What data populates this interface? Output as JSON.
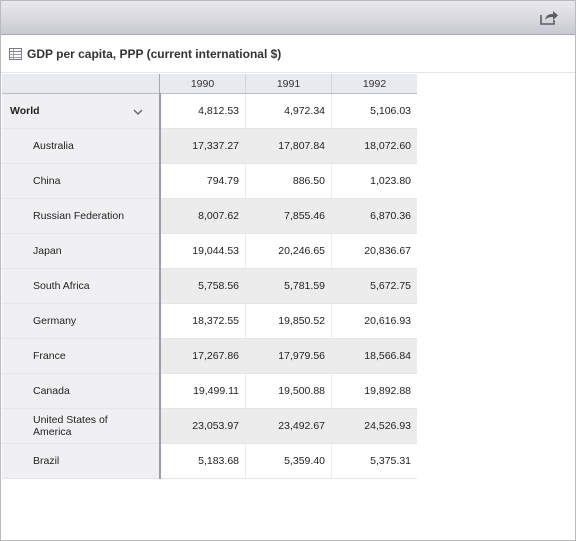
{
  "header": {
    "title": "GDP per capita, PPP (current international $)",
    "share_icon": "share-icon",
    "table_icon": "table-icon"
  },
  "table": {
    "columns": [
      "1990",
      "1991",
      "1992"
    ],
    "rows": [
      {
        "label": "World",
        "values": [
          "4,812.53",
          "4,972.34",
          "5,106.03"
        ]
      },
      {
        "label": "Australia",
        "values": [
          "17,337.27",
          "17,807.84",
          "18,072.60"
        ]
      },
      {
        "label": "China",
        "values": [
          "794.79",
          "886.50",
          "1,023.80"
        ]
      },
      {
        "label": "Russian Federation",
        "values": [
          "8,007.62",
          "7,855.46",
          "6,870.36"
        ]
      },
      {
        "label": "Japan",
        "values": [
          "19,044.53",
          "20,246.65",
          "20,836.67"
        ]
      },
      {
        "label": "South Africa",
        "values": [
          "5,758.56",
          "5,781.59",
          "5,672.75"
        ]
      },
      {
        "label": "Germany",
        "values": [
          "18,372.55",
          "19,850.52",
          "20,616.93"
        ]
      },
      {
        "label": "France",
        "values": [
          "17,267.86",
          "17,979.56",
          "18,566.84"
        ]
      },
      {
        "label": "Canada",
        "values": [
          "19,499.11",
          "19,500.88",
          "19,892.88"
        ]
      },
      {
        "label": "United States of America",
        "values": [
          "23,053.97",
          "23,492.67",
          "24,526.93"
        ]
      },
      {
        "label": "Brazil",
        "values": [
          "5,183.68",
          "5,359.40",
          "5,375.31"
        ]
      }
    ]
  }
}
